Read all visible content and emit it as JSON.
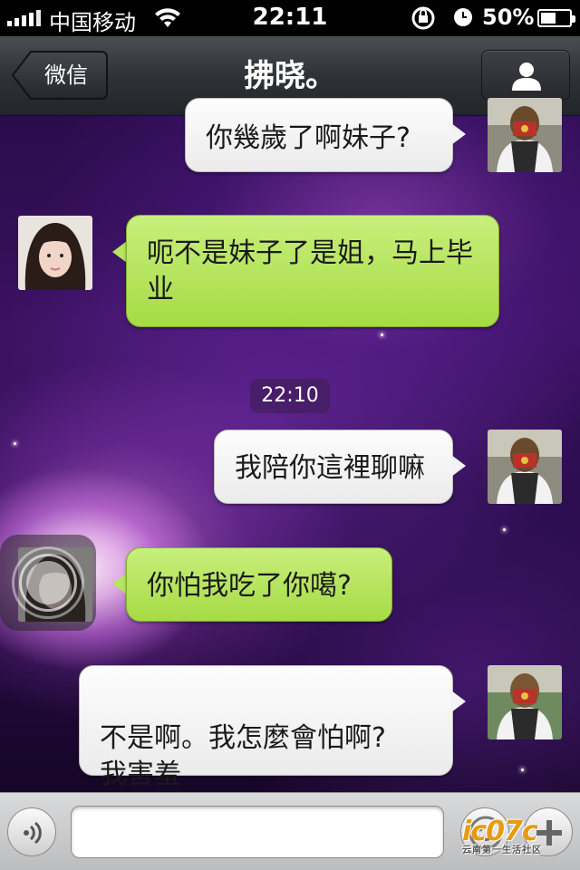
{
  "status_bar": {
    "carrier": "中国移动",
    "time": "22:11",
    "battery_percent": "50%",
    "battery_level": 0.5,
    "signal_bars": 5
  },
  "nav": {
    "back_label": "微信",
    "title": "拂晓。",
    "profile_icon": "person-icon"
  },
  "messages": [
    {
      "direction": "outgoing",
      "text": "你幾歲了啊妹子?",
      "avatar": "contact-avatar"
    },
    {
      "direction": "incoming",
      "text": "呃不是妹子了是姐，马上毕业",
      "avatar": "self-avatar"
    },
    {
      "type": "timestamp",
      "text": "22:10"
    },
    {
      "direction": "outgoing",
      "text": "我陪你這裡聊嘛",
      "avatar": "contact-avatar"
    },
    {
      "direction": "incoming",
      "text": "你怕我吃了你噶?",
      "avatar": "self-avatar"
    },
    {
      "direction": "outgoing",
      "text": "不是啊。我怎麼會怕啊?\n我害羞",
      "avatar": "contact-avatar"
    }
  ],
  "input_bar": {
    "placeholder": "",
    "value": ""
  },
  "watermark": {
    "text": "ic07c",
    "subtext": "云南第一生活社区"
  },
  "colors": {
    "incoming_bubble": "#b5e35a",
    "outgoing_bubble": "#f5f5f5",
    "nav_bg": "#2f3236",
    "status_bg": "#000000"
  }
}
